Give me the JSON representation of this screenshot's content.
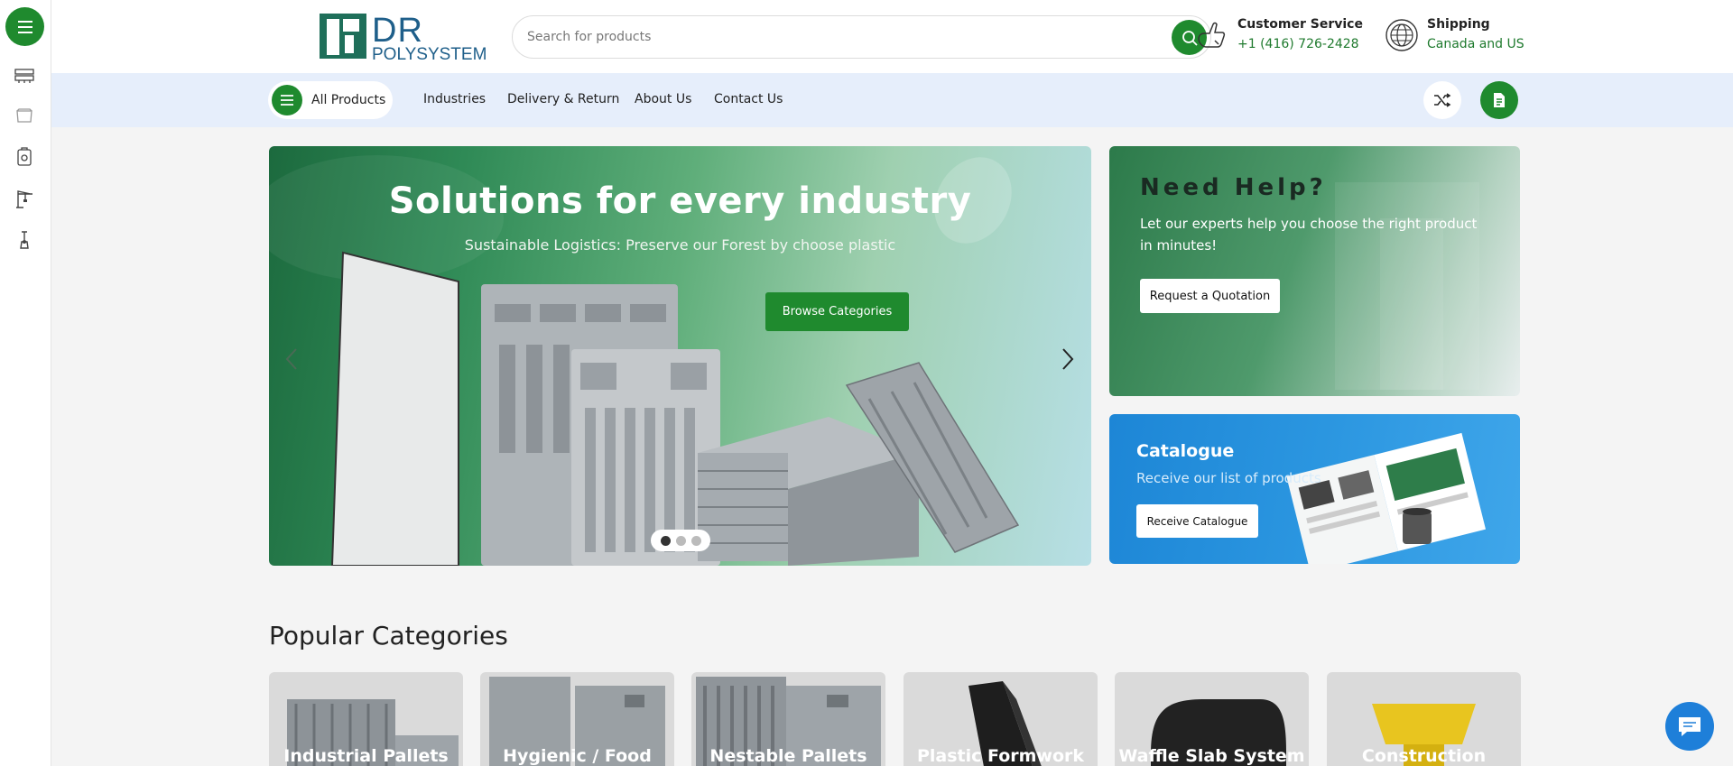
{
  "rail": {
    "icons": [
      "menu-icon",
      "pallet-icon",
      "container-icon",
      "hygiene-pallet-icon",
      "construction-icon",
      "formwork-icon"
    ]
  },
  "header": {
    "logo_dr": "DR",
    "logo_poly": "POLYSYSTEM",
    "search_placeholder": "Search for products",
    "customer_service_label": "Customer Service",
    "customer_service_phone": "+1 (416) 726-2428",
    "shipping_label": "Shipping",
    "shipping_value": "Canada and US"
  },
  "nav": {
    "all_products": "All Products",
    "links": [
      "Industries",
      "Delivery & Return",
      "About Us",
      "Contact Us"
    ]
  },
  "hero": {
    "title": "Solutions for every industry",
    "subtitle": "Sustainable Logistics: Preserve our Forest by choose plastic",
    "button": "Browse Categories",
    "slides": 3,
    "active_slide": 1
  },
  "help": {
    "title": "Need Help?",
    "text": "Let our experts help you choose the right product in minutes!",
    "button": "Request a Quotation"
  },
  "catalogue": {
    "title": "Catalogue",
    "text": "Receive our list of products",
    "button": "Receive Catalogue"
  },
  "popular": {
    "title": "Popular Categories",
    "items": [
      "Industrial Pallets",
      "Hygienic / Food",
      "Nestable Pallets",
      "Plastic Formwork",
      "Waffle Slab System",
      "Construction"
    ]
  },
  "colors": {
    "brand_green": "#1f8a2e",
    "brand_blue": "#1f5f8a",
    "nav_bg": "#e6eefb",
    "chat_blue": "#1e7fd9"
  }
}
